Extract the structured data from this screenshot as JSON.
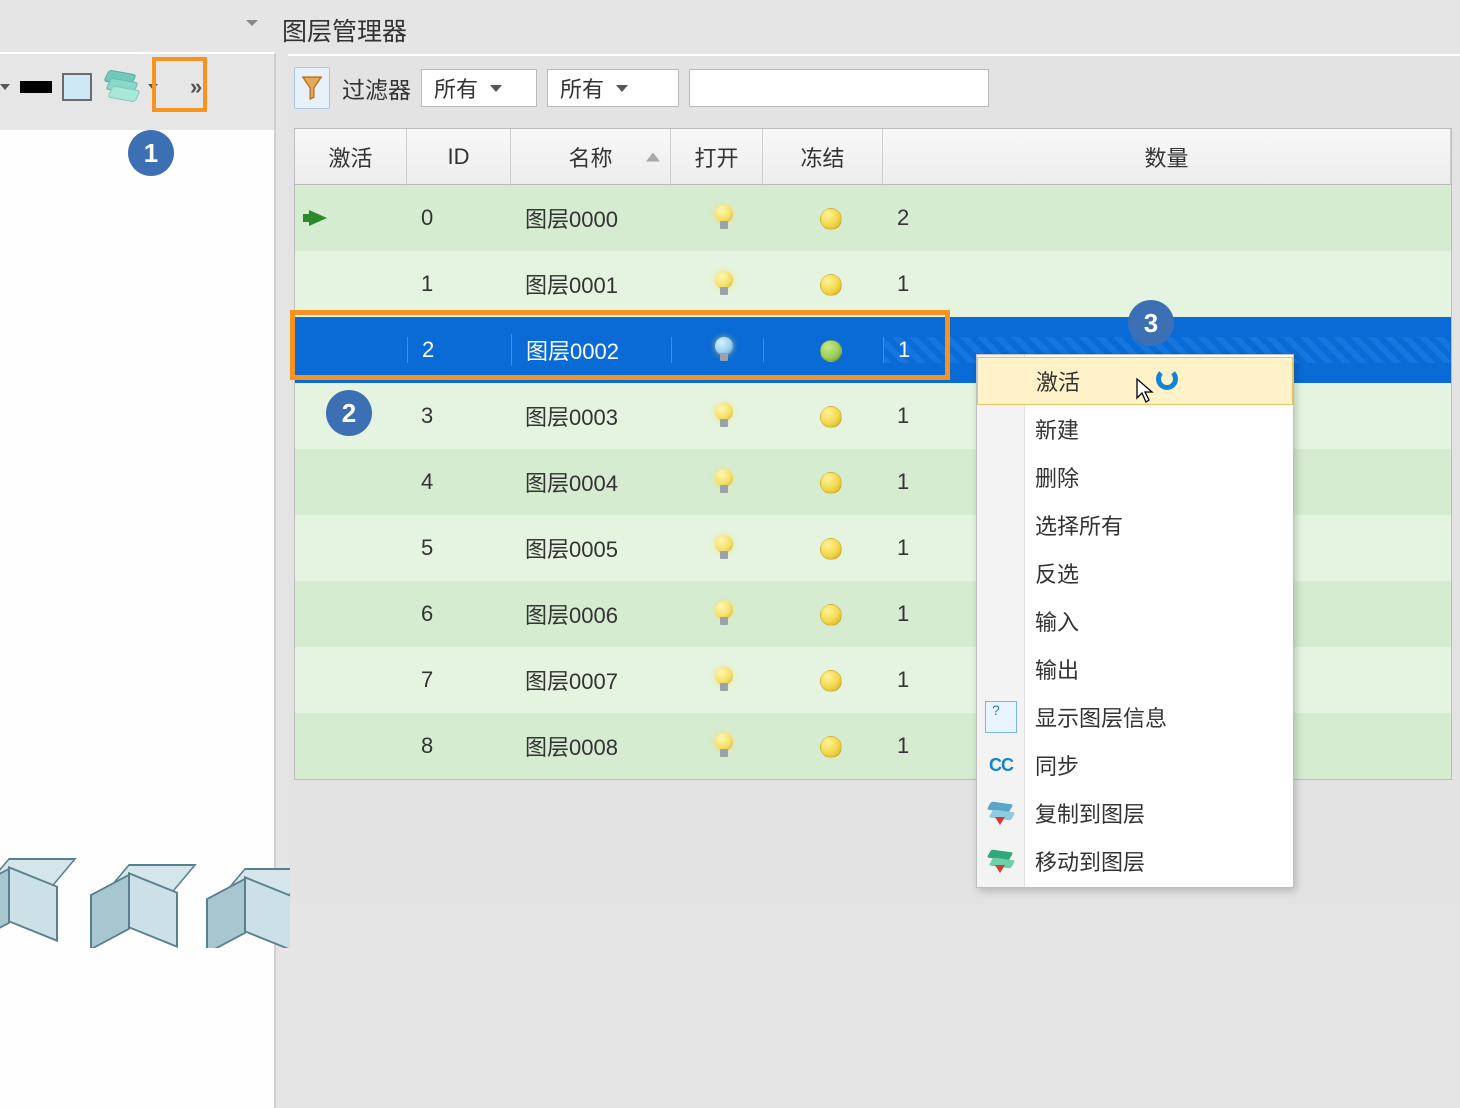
{
  "panel_title": "图层管理器",
  "callouts": {
    "c1": "1",
    "c2": "2",
    "c3": "3"
  },
  "toolbar": {
    "filter_label": "过滤器",
    "combo1": "所有",
    "combo2": "所有",
    "search_value": ""
  },
  "columns": {
    "activate": "激活",
    "id": "ID",
    "name": "名称",
    "open": "打开",
    "freeze": "冻结",
    "quantity": "数量"
  },
  "rows": [
    {
      "active": true,
      "id": "0",
      "name": "图层0000",
      "open": true,
      "frozen": false,
      "qty": "2",
      "selected": false
    },
    {
      "active": false,
      "id": "1",
      "name": "图层0001",
      "open": true,
      "frozen": false,
      "qty": "1",
      "selected": false
    },
    {
      "active": false,
      "id": "2",
      "name": "图层0002",
      "open": true,
      "frozen": false,
      "qty": "1",
      "selected": true
    },
    {
      "active": false,
      "id": "3",
      "name": "图层0003",
      "open": true,
      "frozen": false,
      "qty": "1",
      "selected": false
    },
    {
      "active": false,
      "id": "4",
      "name": "图层0004",
      "open": true,
      "frozen": false,
      "qty": "1",
      "selected": false
    },
    {
      "active": false,
      "id": "5",
      "name": "图层0005",
      "open": true,
      "frozen": false,
      "qty": "1",
      "selected": false
    },
    {
      "active": false,
      "id": "6",
      "name": "图层0006",
      "open": true,
      "frozen": false,
      "qty": "1",
      "selected": false
    },
    {
      "active": false,
      "id": "7",
      "name": "图层0007",
      "open": true,
      "frozen": false,
      "qty": "1",
      "selected": false
    },
    {
      "active": false,
      "id": "8",
      "name": "图层0008",
      "open": true,
      "frozen": false,
      "qty": "1",
      "selected": false
    }
  ],
  "context_menu": {
    "items": [
      {
        "label": "激活",
        "highlight": true,
        "icon": ""
      },
      {
        "label": "新建",
        "highlight": false,
        "icon": ""
      },
      {
        "label": "删除",
        "highlight": false,
        "icon": ""
      },
      {
        "label": "选择所有",
        "highlight": false,
        "icon": ""
      },
      {
        "label": "反选",
        "highlight": false,
        "icon": ""
      },
      {
        "label": "输入",
        "highlight": false,
        "icon": ""
      },
      {
        "label": "输出",
        "highlight": false,
        "icon": ""
      },
      {
        "label": "显示图层信息",
        "highlight": false,
        "icon": "doc"
      },
      {
        "label": "同步",
        "highlight": false,
        "icon": "cc"
      },
      {
        "label": "复制到图层",
        "highlight": false,
        "icon": "copy"
      },
      {
        "label": "移动到图层",
        "highlight": false,
        "icon": "move"
      }
    ]
  }
}
